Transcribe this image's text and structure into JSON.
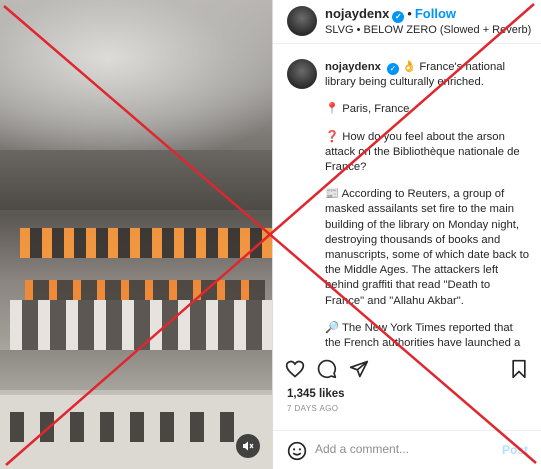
{
  "header": {
    "username": "nojaydenx",
    "separator": "•",
    "follow_label": "Follow",
    "audio": "SLVG • BELOW ZERO (Slowed + Reverb)"
  },
  "caption": {
    "username": "nojaydenx",
    "line1": "👌 France's national library being culturally enriched.",
    "location": "📍 Paris, France",
    "question": "❓ How do you feel about the arson attack on the Bibliothèque nationale de France?",
    "reuters": "📰 According to Reuters, a group of masked assailants set fire to the main building of the library on Monday night, destroying thousands of books and manuscripts, some of which date back to the Middle Ages. The attackers left behind graffiti that read \"Death to France\" and \"Allahu Akbar\".",
    "nyt": "🔎 The New York Times reported that the French authorities have launched a"
  },
  "actions": {
    "like_icon": "heart-icon",
    "comment_icon": "comment-icon",
    "share_icon": "share-icon",
    "save_icon": "bookmark-icon"
  },
  "likes": "1,345 likes",
  "time": "7 DAYS AGO",
  "comment": {
    "placeholder": "Add a comment...",
    "post_label": "Post"
  },
  "colors": {
    "accent": "#0095f6",
    "overlay_cross": "#e0262e"
  }
}
